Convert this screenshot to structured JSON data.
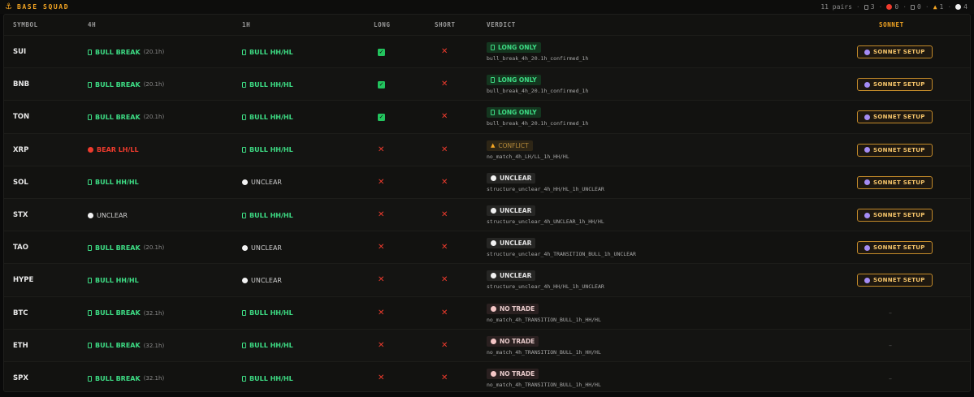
{
  "header": {
    "title": "BASE SQUAD",
    "pairs": "11 pairs",
    "count_a": "3",
    "count_red": "0",
    "count_b": "0",
    "count_warn": "1",
    "count_white": "4"
  },
  "columns": {
    "symbol": "SYMBOL",
    "h4": "4H",
    "h1": "1H",
    "long": "LONG",
    "short": "SHORT",
    "verdict": "VERDICT",
    "sonnet": "SONNET"
  },
  "sonnet_label": "SONNET SETUP",
  "rows": [
    {
      "symbol": "SUI",
      "h4": {
        "kind": "bull",
        "label": "BULL BREAK",
        "sub": "(20.1h)"
      },
      "h1": {
        "kind": "bull",
        "label": "BULL HH/HL",
        "sub": ""
      },
      "long": true,
      "short": false,
      "verdict": {
        "kind": "long",
        "label": "LONG ONLY",
        "code": "bull_break_4h_20.1h_confirmed_1h"
      },
      "sonnet": true
    },
    {
      "symbol": "BNB",
      "h4": {
        "kind": "bull",
        "label": "BULL BREAK",
        "sub": "(20.1h)"
      },
      "h1": {
        "kind": "bull",
        "label": "BULL HH/HL",
        "sub": ""
      },
      "long": true,
      "short": false,
      "verdict": {
        "kind": "long",
        "label": "LONG ONLY",
        "code": "bull_break_4h_20.1h_confirmed_1h"
      },
      "sonnet": true
    },
    {
      "symbol": "TON",
      "h4": {
        "kind": "bull",
        "label": "BULL BREAK",
        "sub": "(20.1h)"
      },
      "h1": {
        "kind": "bull",
        "label": "BULL HH/HL",
        "sub": ""
      },
      "long": true,
      "short": false,
      "verdict": {
        "kind": "long",
        "label": "LONG ONLY",
        "code": "bull_break_4h_20.1h_confirmed_1h"
      },
      "sonnet": true
    },
    {
      "symbol": "XRP",
      "h4": {
        "kind": "bear",
        "label": "BEAR LH/LL",
        "sub": ""
      },
      "h1": {
        "kind": "bull",
        "label": "BULL HH/HL",
        "sub": ""
      },
      "long": false,
      "short": false,
      "verdict": {
        "kind": "conflict",
        "label": "CONFLICT",
        "code": "no_match_4h_LH/LL_1h_HH/HL"
      },
      "sonnet": true
    },
    {
      "symbol": "SOL",
      "h4": {
        "kind": "bull",
        "label": "BULL HH/HL",
        "sub": ""
      },
      "h1": {
        "kind": "unclear",
        "label": "UNCLEAR",
        "sub": ""
      },
      "long": false,
      "short": false,
      "verdict": {
        "kind": "unclear",
        "label": "UNCLEAR",
        "code": "structure_unclear_4h_HH/HL_1h_UNCLEAR"
      },
      "sonnet": true
    },
    {
      "symbol": "STX",
      "h4": {
        "kind": "unclear",
        "label": "UNCLEAR",
        "sub": ""
      },
      "h1": {
        "kind": "bull",
        "label": "BULL HH/HL",
        "sub": ""
      },
      "long": false,
      "short": false,
      "verdict": {
        "kind": "unclear",
        "label": "UNCLEAR",
        "code": "structure_unclear_4h_UNCLEAR_1h_HH/HL"
      },
      "sonnet": true
    },
    {
      "symbol": "TAO",
      "h4": {
        "kind": "bull",
        "label": "BULL BREAK",
        "sub": "(20.1h)"
      },
      "h1": {
        "kind": "unclear",
        "label": "UNCLEAR",
        "sub": ""
      },
      "long": false,
      "short": false,
      "verdict": {
        "kind": "unclear",
        "label": "UNCLEAR",
        "code": "structure_unclear_4h_TRANSITION_BULL_1h_UNCLEAR"
      },
      "sonnet": true
    },
    {
      "symbol": "HYPE",
      "h4": {
        "kind": "bull",
        "label": "BULL HH/HL",
        "sub": ""
      },
      "h1": {
        "kind": "unclear",
        "label": "UNCLEAR",
        "sub": ""
      },
      "long": false,
      "short": false,
      "verdict": {
        "kind": "unclear",
        "label": "UNCLEAR",
        "code": "structure_unclear_4h_HH/HL_1h_UNCLEAR"
      },
      "sonnet": true
    },
    {
      "symbol": "BTC",
      "h4": {
        "kind": "bull",
        "label": "BULL BREAK",
        "sub": "(32.1h)"
      },
      "h1": {
        "kind": "bull",
        "label": "BULL HH/HL",
        "sub": ""
      },
      "long": false,
      "short": false,
      "verdict": {
        "kind": "notrade",
        "label": "NO TRADE",
        "code": "no_match_4h_TRANSITION_BULL_1h_HH/HL"
      },
      "sonnet": false
    },
    {
      "symbol": "ETH",
      "h4": {
        "kind": "bull",
        "label": "BULL BREAK",
        "sub": "(32.1h)"
      },
      "h1": {
        "kind": "bull",
        "label": "BULL HH/HL",
        "sub": ""
      },
      "long": false,
      "short": false,
      "verdict": {
        "kind": "notrade",
        "label": "NO TRADE",
        "code": "no_match_4h_TRANSITION_BULL_1h_HH/HL"
      },
      "sonnet": false
    },
    {
      "symbol": "SPX",
      "h4": {
        "kind": "bull",
        "label": "BULL BREAK",
        "sub": "(32.1h)"
      },
      "h1": {
        "kind": "bull",
        "label": "BULL HH/HL",
        "sub": ""
      },
      "long": false,
      "short": false,
      "verdict": {
        "kind": "notrade",
        "label": "NO TRADE",
        "code": "no_match_4h_TRANSITION_BULL_1h_HH/HL"
      },
      "sonnet": false
    }
  ],
  "empty_sonnet": "–"
}
